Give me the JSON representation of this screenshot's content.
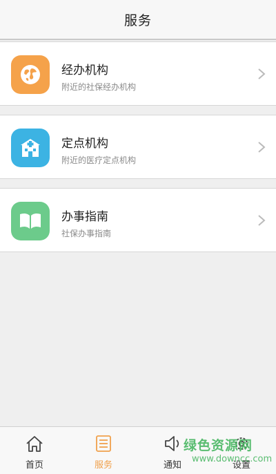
{
  "header": {
    "title": "服务"
  },
  "services": [
    {
      "name": "经办机构",
      "desc": "附近的社保经办机构",
      "icon": "globe-icon",
      "color": "#f5a24a"
    },
    {
      "name": "定点机构",
      "desc": "附近的医疗定点机构",
      "icon": "hospital-icon",
      "color": "#3cb3e3"
    },
    {
      "name": "办事指南",
      "desc": "社保办事指南",
      "icon": "book-icon",
      "color": "#6ccb8b"
    }
  ],
  "tabs": [
    {
      "label": "首页",
      "icon": "home-icon"
    },
    {
      "label": "服务",
      "icon": "list-icon",
      "active": true
    },
    {
      "label": "通知",
      "icon": "speaker-icon"
    },
    {
      "label": "设置",
      "icon": "gear-icon"
    }
  ],
  "watermark": {
    "line1": "绿色资源网",
    "line2": "www.downcc.com"
  },
  "colors": {
    "accent": "#f0a04b"
  }
}
